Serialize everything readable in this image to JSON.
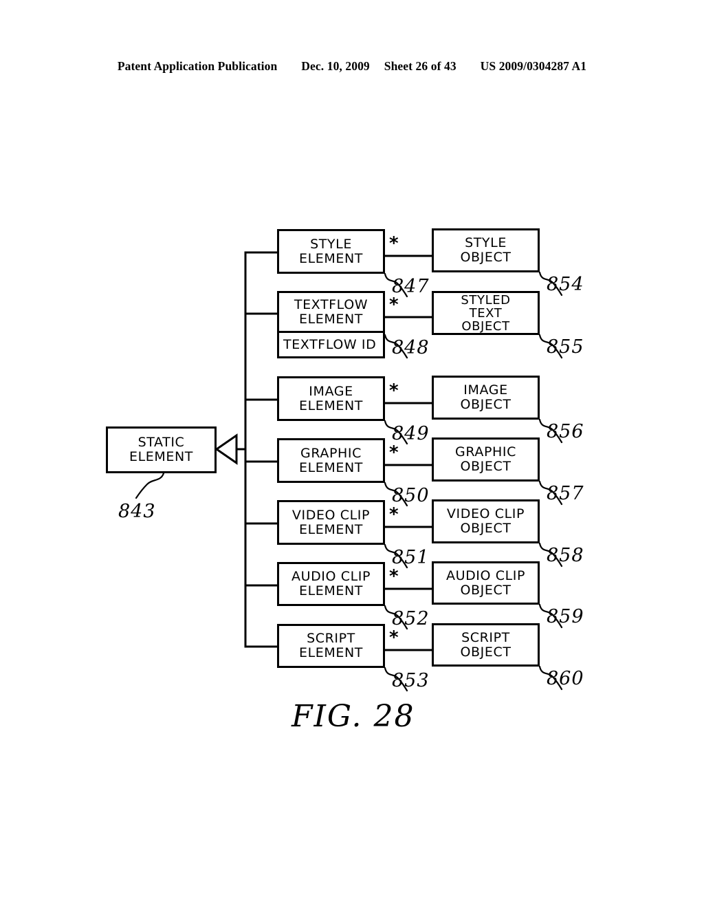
{
  "header": {
    "publication": "Patent Application Publication",
    "date": "Dec. 10, 2009",
    "sheet": "Sheet 26 of 43",
    "patent_number": "US 2009/0304287 A1"
  },
  "figure": {
    "caption": "FIG. 28",
    "multiplicity_symbol": "*",
    "base_class": {
      "label": "STATIC\nELEMENT",
      "ref": "843"
    },
    "rows": [
      {
        "element": {
          "label": "STYLE\nELEMENT",
          "ref": "847"
        },
        "object": {
          "label": "STYLE\nOBJECT",
          "ref": "854"
        }
      },
      {
        "element": {
          "label": "TEXTFLOW\nELEMENT",
          "ref": "848",
          "attribute": "TEXTFLOW ID"
        },
        "object": {
          "label": "STYLED\nTEXT\nOBJECT",
          "ref": "855"
        }
      },
      {
        "element": {
          "label": "IMAGE\nELEMENT",
          "ref": "849"
        },
        "object": {
          "label": "IMAGE\nOBJECT",
          "ref": "856"
        }
      },
      {
        "element": {
          "label": "GRAPHIC\nELEMENT",
          "ref": "850"
        },
        "object": {
          "label": "GRAPHIC\nOBJECT",
          "ref": "857"
        }
      },
      {
        "element": {
          "label": "VIDEO CLIP\nELEMENT",
          "ref": "851"
        },
        "object": {
          "label": "VIDEO CLIP\nOBJECT",
          "ref": "858"
        }
      },
      {
        "element": {
          "label": "AUDIO CLIP\nELEMENT",
          "ref": "852"
        },
        "object": {
          "label": "AUDIO CLIP\nOBJECT",
          "ref": "859"
        }
      },
      {
        "element": {
          "label": "SCRIPT\nELEMENT",
          "ref": "853"
        },
        "object": {
          "label": "SCRIPT\nOBJECT",
          "ref": "860"
        }
      }
    ]
  },
  "colors": {
    "ink": "#000000",
    "paper": "#ffffff"
  }
}
